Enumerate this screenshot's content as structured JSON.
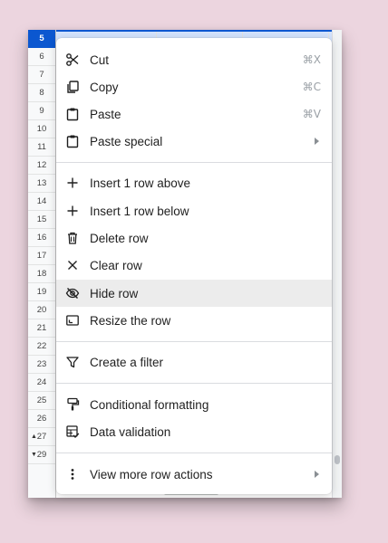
{
  "sheet": {
    "rows": [
      {
        "num": "5",
        "selected": true
      },
      {
        "num": "6"
      },
      {
        "num": "7"
      },
      {
        "num": "8"
      },
      {
        "num": "9"
      },
      {
        "num": "10"
      },
      {
        "num": "11"
      },
      {
        "num": "12"
      },
      {
        "num": "13"
      },
      {
        "num": "14"
      },
      {
        "num": "15"
      },
      {
        "num": "16"
      },
      {
        "num": "17"
      },
      {
        "num": "18"
      },
      {
        "num": "19"
      },
      {
        "num": "20"
      },
      {
        "num": "21"
      },
      {
        "num": "22"
      },
      {
        "num": "23"
      },
      {
        "num": "24"
      },
      {
        "num": "25"
      },
      {
        "num": "26"
      },
      {
        "num": "27",
        "fold": "▲"
      },
      {
        "num": "29",
        "fold": "▼"
      }
    ]
  },
  "menu": {
    "items": [
      {
        "icon": "cut-icon",
        "label": "Cut",
        "shortcut": "⌘X"
      },
      {
        "icon": "copy-icon",
        "label": "Copy",
        "shortcut": "⌘C"
      },
      {
        "icon": "paste-icon",
        "label": "Paste",
        "shortcut": "⌘V"
      },
      {
        "icon": "paste-special-icon",
        "label": "Paste special",
        "submenu": true
      },
      {
        "icon": "plus-icon",
        "label": "Insert 1 row above"
      },
      {
        "icon": "plus-icon",
        "label": "Insert 1 row below"
      },
      {
        "icon": "trash-icon",
        "label": "Delete row"
      },
      {
        "icon": "close-icon",
        "label": "Clear row"
      },
      {
        "icon": "eye-off-icon",
        "label": "Hide row",
        "highlighted": true
      },
      {
        "icon": "resize-icon",
        "label": "Resize the row"
      },
      {
        "icon": "filter-icon",
        "label": "Create a filter"
      },
      {
        "icon": "paint-roller-icon",
        "label": "Conditional formatting"
      },
      {
        "icon": "data-validation-icon",
        "label": "Data validation"
      },
      {
        "icon": "more-vert-icon",
        "label": "View more row actions",
        "submenu": true
      }
    ]
  }
}
